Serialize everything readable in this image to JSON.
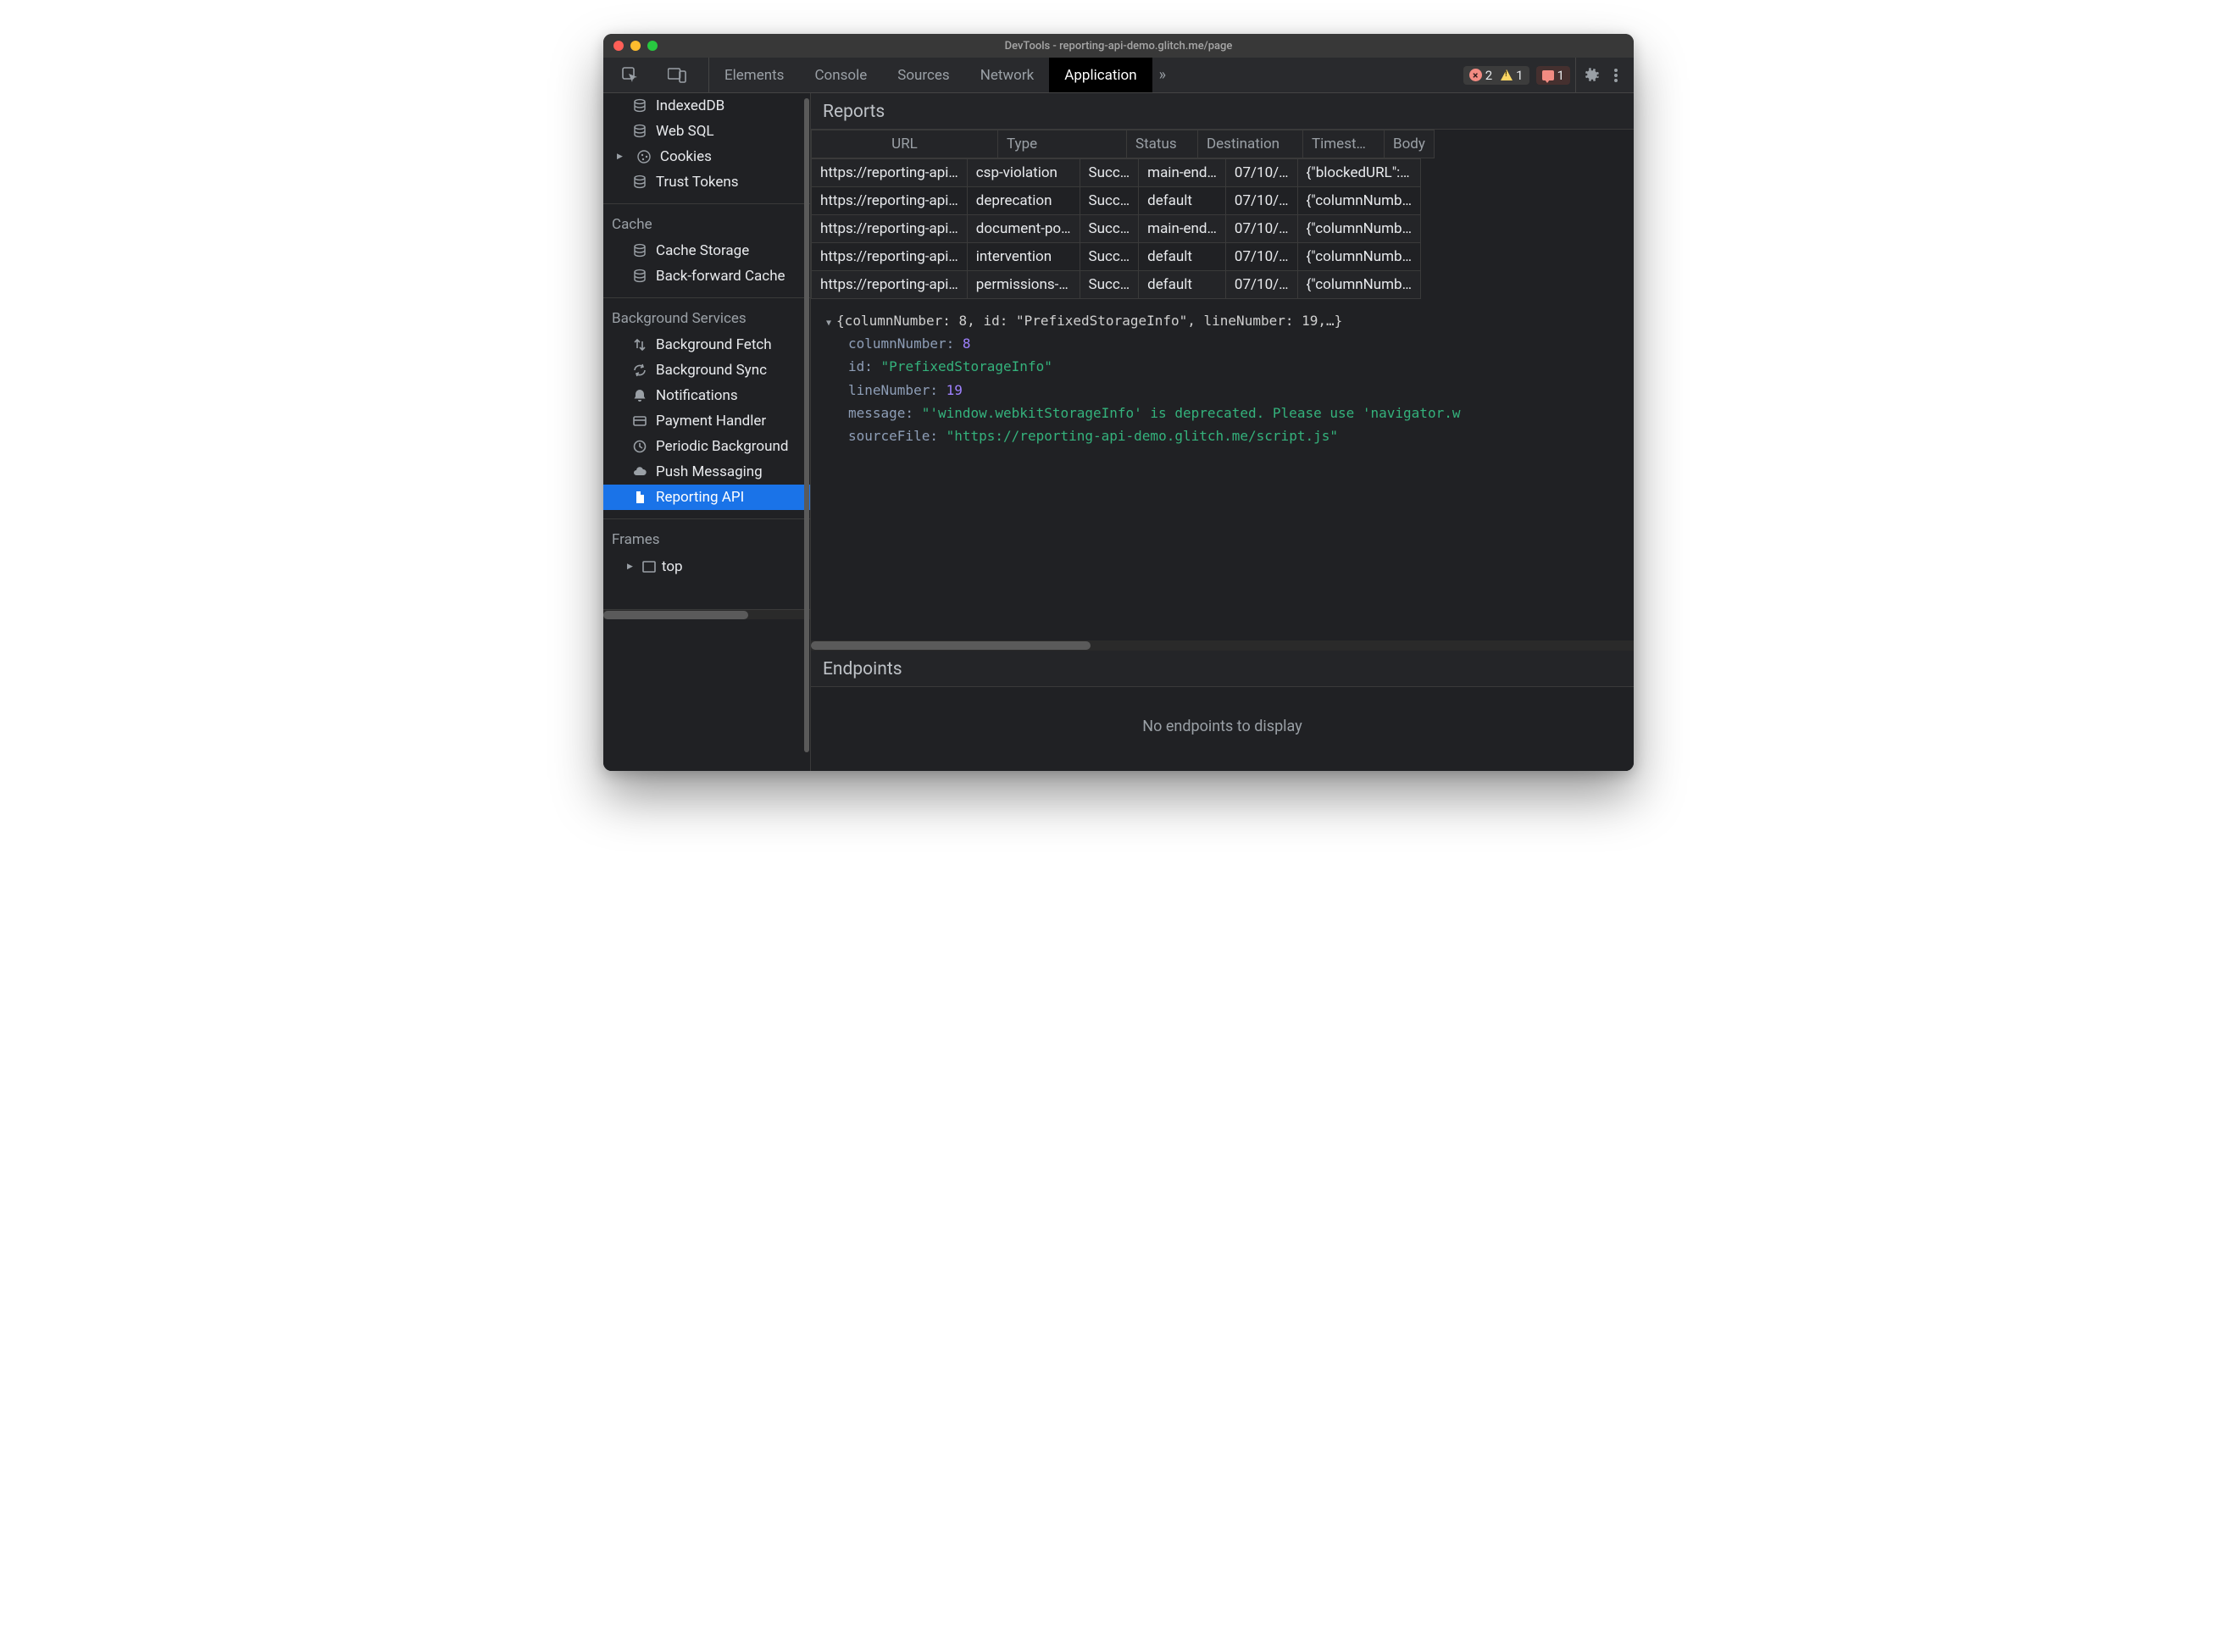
{
  "window_title": "DevTools - reporting-api-demo.glitch.me/page",
  "toolbar": {
    "tabs": [
      "Elements",
      "Console",
      "Sources",
      "Network",
      "Application"
    ],
    "active_tab": "Application",
    "overflow": "»",
    "err_count": "2",
    "warn_count": "1",
    "msgerr_count": "1"
  },
  "sidebar": {
    "storage_items": [
      {
        "label": "IndexedDB",
        "icon": "db"
      },
      {
        "label": "Web SQL",
        "icon": "db"
      },
      {
        "label": "Cookies",
        "icon": "cookie",
        "expandable": true
      },
      {
        "label": "Trust Tokens",
        "icon": "db"
      }
    ],
    "cache_title": "Cache",
    "cache_items": [
      {
        "label": "Cache Storage",
        "icon": "db"
      },
      {
        "label": "Back-forward Cache",
        "icon": "db"
      }
    ],
    "bg_title": "Background Services",
    "bg_items": [
      {
        "label": "Background Fetch",
        "icon": "updown"
      },
      {
        "label": "Background Sync",
        "icon": "sync"
      },
      {
        "label": "Notifications",
        "icon": "bell"
      },
      {
        "label": "Payment Handler",
        "icon": "card"
      },
      {
        "label": "Periodic Background",
        "icon": "clock"
      },
      {
        "label": "Push Messaging",
        "icon": "cloud"
      },
      {
        "label": "Reporting API",
        "icon": "file",
        "selected": true
      }
    ],
    "frames_title": "Frames",
    "frames_item": "top"
  },
  "reports": {
    "title": "Reports",
    "columns": [
      "URL",
      "Type",
      "Status",
      "Destination",
      "Timest…",
      "Body"
    ],
    "rows": [
      {
        "url": "https://reporting-api…",
        "type": "csp-violation",
        "status": "Succ…",
        "dest": "main-end…",
        "ts": "07/10/…",
        "body": "{\"blockedURL\":…"
      },
      {
        "url": "https://reporting-api…",
        "type": "deprecation",
        "status": "Succ…",
        "dest": "default",
        "ts": "07/10/…",
        "body": "{\"columnNumb…"
      },
      {
        "url": "https://reporting-api…",
        "type": "document-po…",
        "status": "Succ…",
        "dest": "main-end…",
        "ts": "07/10/…",
        "body": "{\"columnNumb…"
      },
      {
        "url": "https://reporting-api…",
        "type": "intervention",
        "status": "Succ…",
        "dest": "default",
        "ts": "07/10/…",
        "body": "{\"columnNumb…"
      },
      {
        "url": "https://reporting-api…",
        "type": "permissions-…",
        "status": "Succ…",
        "dest": "default",
        "ts": "07/10/…",
        "body": "{\"columnNumb…"
      }
    ]
  },
  "detail": {
    "summary": "{columnNumber: 8, id: \"PrefixedStorageInfo\", lineNumber: 19,…}",
    "columnNumber_key": "columnNumber:",
    "columnNumber_val": "8",
    "id_key": "id:",
    "id_val": "\"PrefixedStorageInfo\"",
    "lineNumber_key": "lineNumber:",
    "lineNumber_val": "19",
    "message_key": "message:",
    "message_val": "\"'window.webkitStorageInfo' is deprecated. Please use 'navigator.w",
    "sourceFile_key": "sourceFile:",
    "sourceFile_val": "\"https://reporting-api-demo.glitch.me/script.js\""
  },
  "endpoints": {
    "title": "Endpoints",
    "empty": "No endpoints to display"
  }
}
